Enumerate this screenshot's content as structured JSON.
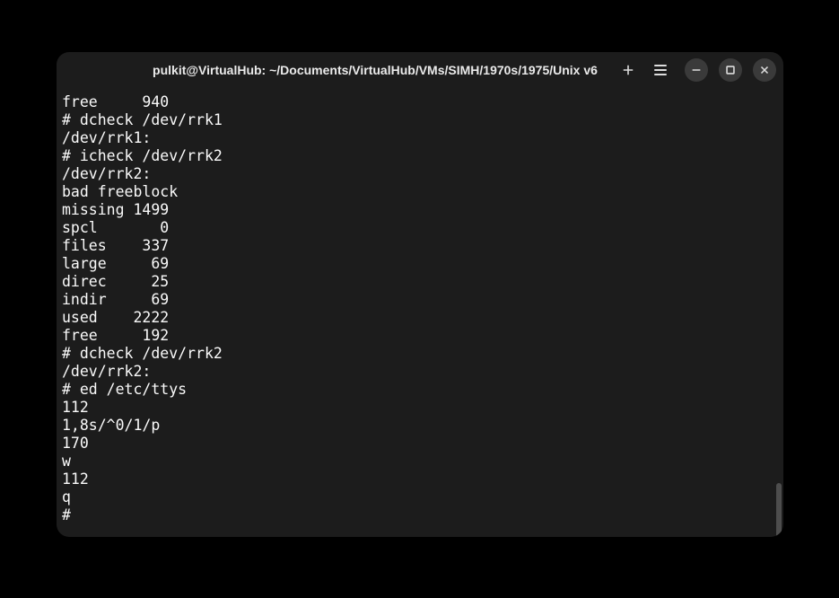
{
  "window": {
    "title": "pulkit@VirtualHub: ~/Documents/VirtualHub/VMs/SIMH/1970s/1975/Unix v6"
  },
  "terminal": {
    "lines": [
      "free     940",
      "# dcheck /dev/rrk1",
      "/dev/rrk1:",
      "# icheck /dev/rrk2",
      "/dev/rrk2:",
      "bad freeblock",
      "missing 1499",
      "spcl       0",
      "files    337",
      "large     69",
      "direc     25",
      "indir     69",
      "used    2222",
      "free     192",
      "# dcheck /dev/rrk2",
      "/dev/rrk2:",
      "# ed /etc/ttys",
      "112",
      "1,8s/^0/1/p",
      "170",
      "w",
      "112",
      "q",
      "# "
    ]
  }
}
